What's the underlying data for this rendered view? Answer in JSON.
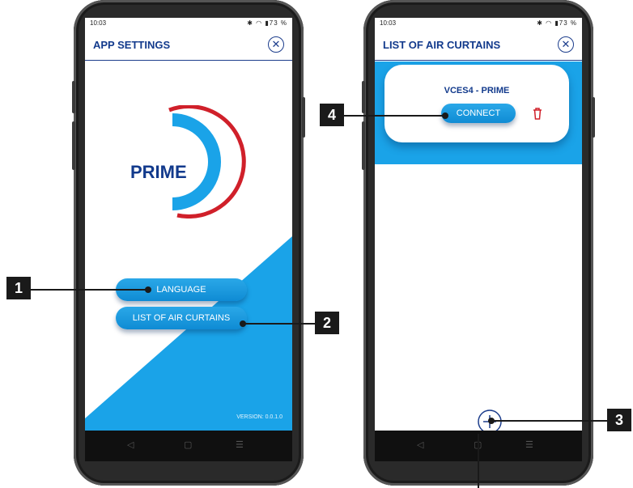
{
  "left_screen": {
    "status_time": "10:03",
    "status_icons": "✱ ◠ ▮73 %",
    "title": "APP SETTINGS",
    "logo_text": "PRIME",
    "language_button": "LANGUAGE",
    "list_button": "LIST OF AIR CURTAINS",
    "version": "VERSION: 0.0.1.0"
  },
  "right_screen": {
    "status_time": "10:03",
    "status_icons": "✱ ◠ ▮73 %",
    "title": "LIST OF AIR CURTAINS",
    "device_name": "VCES4 - PRIME",
    "connect_button": "CONNECT"
  },
  "navbar": {
    "back": "◁",
    "home": "▢",
    "menu": "☰"
  },
  "callouts": [
    "1",
    "2",
    "3",
    "4"
  ],
  "colors": {
    "brand_blue": "#123a8c",
    "accent_blue": "#1aa3e8",
    "logo_red": "#d0202a"
  },
  "icons": {
    "close": "close-icon",
    "delete": "trash-icon",
    "add": "plus-circle-icon"
  }
}
